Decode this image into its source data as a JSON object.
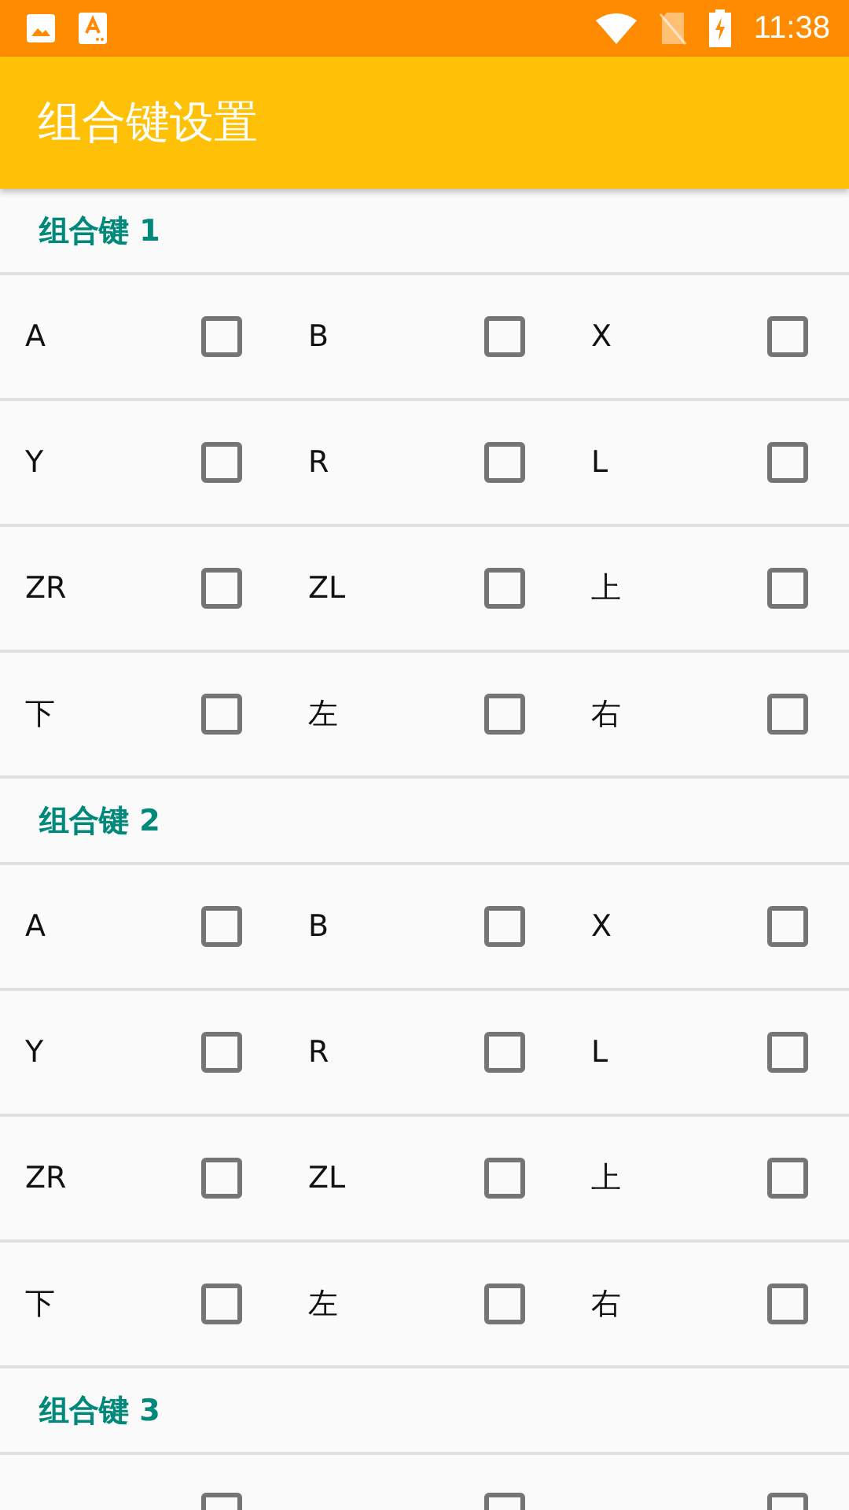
{
  "status_bar": {
    "time": "11:38"
  },
  "app_bar": {
    "title": "组合键设置"
  },
  "groups": [
    {
      "title": "组合键 1",
      "rows": [
        {
          "items": [
            {
              "label": "A",
              "checked": false
            },
            {
              "label": "B",
              "checked": false
            },
            {
              "label": "X",
              "checked": false
            }
          ]
        },
        {
          "items": [
            {
              "label": "Y",
              "checked": false
            },
            {
              "label": "R",
              "checked": false
            },
            {
              "label": "L",
              "checked": false
            }
          ]
        },
        {
          "items": [
            {
              "label": "ZR",
              "checked": false
            },
            {
              "label": "ZL",
              "checked": false
            },
            {
              "label": "上",
              "checked": false
            }
          ]
        },
        {
          "items": [
            {
              "label": "下",
              "checked": false
            },
            {
              "label": "左",
              "checked": false
            },
            {
              "label": "右",
              "checked": false
            }
          ]
        }
      ]
    },
    {
      "title": "组合键 2",
      "rows": [
        {
          "items": [
            {
              "label": "A",
              "checked": false
            },
            {
              "label": "B",
              "checked": false
            },
            {
              "label": "X",
              "checked": false
            }
          ]
        },
        {
          "items": [
            {
              "label": "Y",
              "checked": false
            },
            {
              "label": "R",
              "checked": false
            },
            {
              "label": "L",
              "checked": false
            }
          ]
        },
        {
          "items": [
            {
              "label": "ZR",
              "checked": false
            },
            {
              "label": "ZL",
              "checked": false
            },
            {
              "label": "上",
              "checked": false
            }
          ]
        },
        {
          "items": [
            {
              "label": "下",
              "checked": false
            },
            {
              "label": "左",
              "checked": false
            },
            {
              "label": "右",
              "checked": false
            }
          ]
        }
      ]
    },
    {
      "title": "组合键 3",
      "rows": [
        {
          "items": [
            {
              "checked": false
            },
            {
              "checked": false
            },
            {
              "checked": false
            }
          ]
        }
      ]
    }
  ]
}
